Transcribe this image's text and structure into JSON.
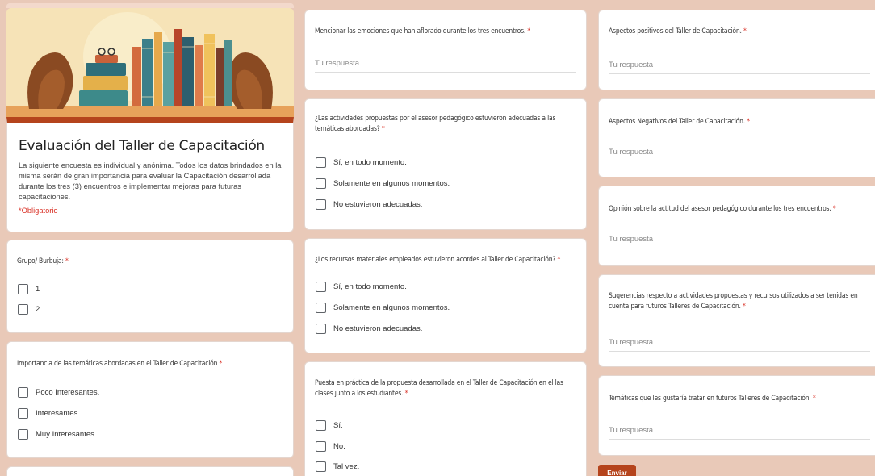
{
  "form": {
    "title": "Evaluación del Taller de Capacitación",
    "description": "La siguiente encuesta es individual y anónima. Todos los datos brindados en la misma serán de gran importancia para evaluar la Capacitación desarrollada durante los tres (3) encuentros e implementar mejoras para futuras capacitaciones.",
    "required_note": "*Obligatorio",
    "answer_placeholder": "Tu respuesta",
    "submit_label": "Enviar"
  },
  "questions": {
    "grupo": {
      "label": "Grupo/ Burbuja:",
      "required": "*",
      "options": [
        "1",
        "2"
      ]
    },
    "importancia": {
      "label": "Importancia de las temáticas abordadas en el Taller de Capacitación",
      "required": "*",
      "options": [
        "Poco Interesantes.",
        "Interesantes.",
        "Muy Interesantes."
      ]
    },
    "emociones": {
      "label": "Mencionar las emociones que han aflorado durante los tres encuentros.",
      "required": "*"
    },
    "actividades": {
      "label": "¿Las actividades propuestas por el asesor pedagógico estuvieron adecuadas a las temáticas abordadas?",
      "required": "*",
      "options": [
        "Sí, en todo momento.",
        "Solamente en algunos momentos.",
        "No estuvieron adecuadas."
      ]
    },
    "recursos": {
      "label": "¿Los recursos materiales empleados estuvieron acordes al Taller de Capacitación?",
      "required": "*",
      "options": [
        "Sí, en todo momento.",
        "Solamente en algunos momentos.",
        "No estuvieron adecuadas."
      ]
    },
    "practica": {
      "label": "Puesta en práctica de la propuesta desarrollada en el Taller de Capacitación en el las clases junto a los estudiantes.",
      "required": "*",
      "options": [
        "Sí.",
        "No.",
        "Tal vez."
      ]
    },
    "positivos": {
      "label": "Aspectos positivos del Taller de Capacitación.",
      "required": "*"
    },
    "negativos": {
      "label": "Aspectos Negativos del Taller de Capacitación.",
      "required": "*"
    },
    "opinion": {
      "label": "Opinión sobre la actitud del asesor pedagógico durante los tres encuentros.",
      "required": "*"
    },
    "sugerencias": {
      "label": "Sugerencias respecto a actividades propuestas y recursos utilizados a ser tenidas en cuenta para futuros Talleres de Capacitación.",
      "required": "*"
    },
    "tematicas": {
      "label": "Temáticas que les gustaría tratar en futuros Talleres de Capacitación.",
      "required": "*"
    }
  },
  "colors": {
    "accent": "#b5441c",
    "background": "#e9c9b8",
    "required": "#d93025"
  }
}
